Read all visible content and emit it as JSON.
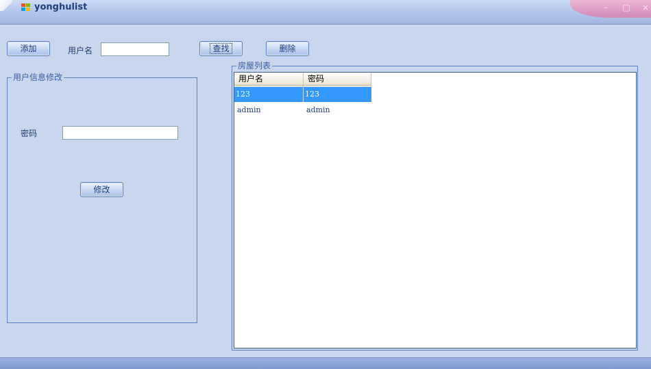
{
  "window": {
    "title": "yonghulist",
    "icon": "app-windows-icon"
  },
  "toolbar": {
    "add_label": "添加",
    "username_label": "用户名",
    "username_value": "",
    "search_label": "查找",
    "delete_label": "删除"
  },
  "edit_group": {
    "title": "用户信息修改",
    "password_label": "密码",
    "password_value": "",
    "modify_label": "修改"
  },
  "list_group": {
    "title": "房屋列表",
    "columns": [
      "用户名",
      "密码"
    ],
    "rows": [
      {
        "username": "123",
        "password": "123",
        "selected": true
      },
      {
        "username": "admin",
        "password": "admin",
        "selected": false
      }
    ]
  }
}
